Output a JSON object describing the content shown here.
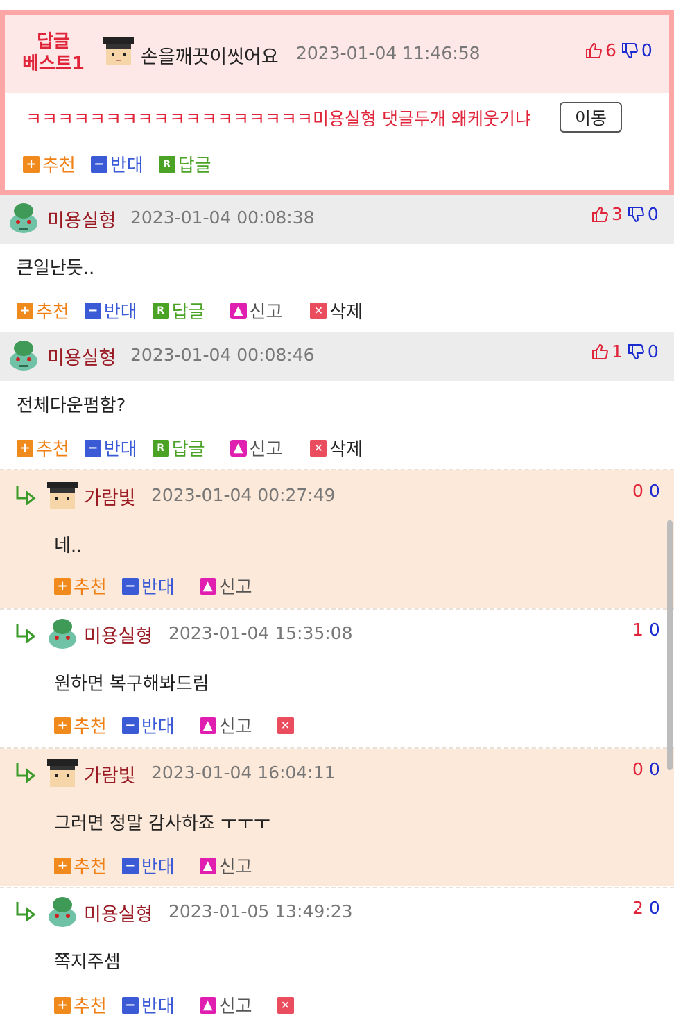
{
  "best": {
    "label_line1": "답글",
    "label_line2": "베스트1",
    "nick": "손을깨끗이씻어요",
    "date": "2023-01-04 11:46:58",
    "up": "6",
    "down": "0",
    "text": "ㅋㅋㅋㅋㅋㅋㅋㅋㅋㅋㅋㅋㅋㅋㅋㅋㅋㅋ미용실형 댓글두개 왜케웃기냐",
    "move_label": "이동",
    "actions": {
      "recommend": "추천",
      "oppose": "반대",
      "reply": "답글"
    }
  },
  "labels": {
    "recommend": "추천",
    "oppose": "반대",
    "reply": "답글",
    "report": "신고",
    "delete": "삭제"
  },
  "comments": [
    {
      "nick": "미용실형",
      "date": "2023-01-04 00:08:38",
      "up": "3",
      "down": "0",
      "text": "큰일난듯.."
    },
    {
      "nick": "미용실형",
      "date": "2023-01-04 00:08:46",
      "up": "1",
      "down": "0",
      "text": "전체다운펌함?"
    }
  ],
  "replies": [
    {
      "nick": "가람빛",
      "date": "2023-01-04 00:27:49",
      "up": "0",
      "down": "0",
      "text": "네.."
    },
    {
      "nick": "미용실형",
      "date": "2023-01-04 15:35:08",
      "up": "1",
      "down": "0",
      "text": "원하면 복구해봐드림"
    },
    {
      "nick": "가람빛",
      "date": "2023-01-04 16:04:11",
      "up": "0",
      "down": "0",
      "text": "그러면 정말 감사하죠 ㅜㅜㅜ"
    },
    {
      "nick": "미용실형",
      "date": "2023-01-05 13:49:23",
      "up": "2",
      "down": "0",
      "text": "쪽지주셈"
    }
  ],
  "colors": {
    "accent_red": "#e0243a",
    "accent_blue": "#1a2bd0",
    "best_border": "#fca6a6",
    "reply_bg": "#fde9d9"
  },
  "icons": [
    "thumbs-up-icon",
    "thumbs-down-icon",
    "plus-icon",
    "minus-icon",
    "reply-r-icon",
    "report-siren-icon",
    "delete-x-icon",
    "reply-arrow-icon"
  ]
}
